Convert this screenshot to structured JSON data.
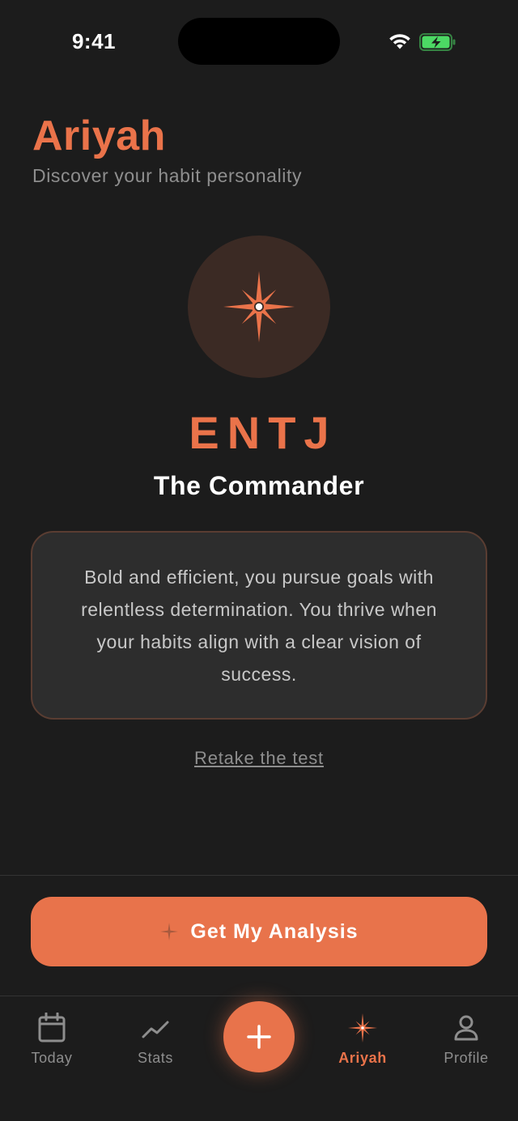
{
  "status_bar": {
    "time": "9:41"
  },
  "header": {
    "title": "Ariyah",
    "subtitle": "Discover your habit personality"
  },
  "result": {
    "code": "ENTJ",
    "name": "The Commander",
    "description": "Bold and efficient, you pursue goals with relentless determination. You thrive when your habits align with a clear vision of success."
  },
  "retake_label": "Retake the test",
  "cta_label": "Get My Analysis",
  "tabs": [
    {
      "label": "Today",
      "icon": "calendar-icon",
      "active": false
    },
    {
      "label": "Stats",
      "icon": "trend-line-icon",
      "active": false
    },
    {
      "label": "Ariyah",
      "icon": "compass-star-icon",
      "active": true
    },
    {
      "label": "Profile",
      "icon": "person-icon",
      "active": false
    }
  ],
  "colors": {
    "accent": "#ea734a",
    "background": "#1c1c1c",
    "card": "#2d2d2d",
    "muted_text": "#8e8e8e"
  }
}
